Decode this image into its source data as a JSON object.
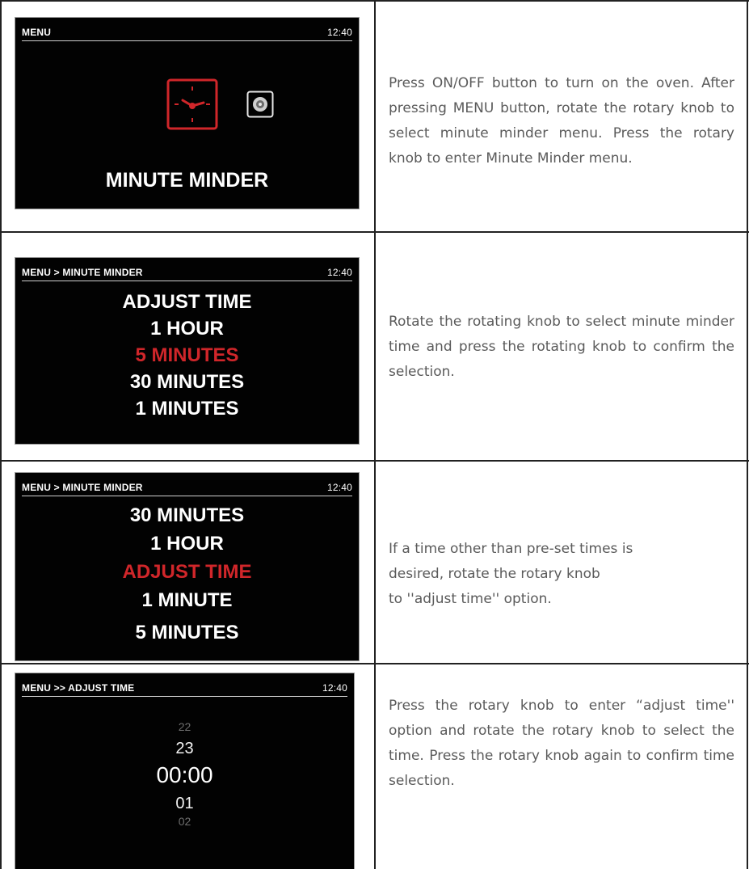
{
  "rows": [
    {
      "screen": {
        "header": "MENU",
        "time": "12:40",
        "label": "MINUTE MINDER",
        "icons": [
          "clock-icon",
          "oven-icon"
        ]
      },
      "description": "Press ON/OFF button to turn on the oven. After pressing MENU button, rotate the rotary knob to select minute minder menu. Press the rotary knob to enter Minute Minder menu."
    },
    {
      "screen": {
        "header": "MENU > MINUTE MINDER",
        "time": "12:40",
        "options": [
          "ADJUST TIME",
          "1 HOUR",
          "5 MINUTES",
          "30 MINUTES",
          "1 MINUTES"
        ],
        "selected": "5 MINUTES"
      },
      "description": "Rotate the rotating knob to select minute minder time and press the rotating knob to confirm the selection."
    },
    {
      "screen": {
        "header": "MENU > MINUTE MINDER",
        "time": "12:40",
        "options": [
          "30 MINUTES",
          "1 HOUR",
          "ADJUST TIME",
          "1 MINUTE",
          "5 MINUTES"
        ],
        "selected": "ADJUST TIME"
      },
      "description_lines": [
        "If a time other than pre-set times is",
        "desired, rotate the rotary knob",
        "to ''adjust time'' option."
      ]
    },
    {
      "screen": {
        "header": "MENU >> ADJUST TIME",
        "time": "12:40",
        "values": [
          "22",
          "23",
          "00:00",
          "01",
          "02"
        ]
      },
      "description": "Press the rotary knob to enter “adjust time'' option and rotate the rotary knob to select the time. Press the rotary knob again to confirm time selection."
    }
  ],
  "colors": {
    "screen_bg": "#020202",
    "highlight": "#d0262a",
    "text": "#5a5a5a",
    "border": "#222222"
  }
}
